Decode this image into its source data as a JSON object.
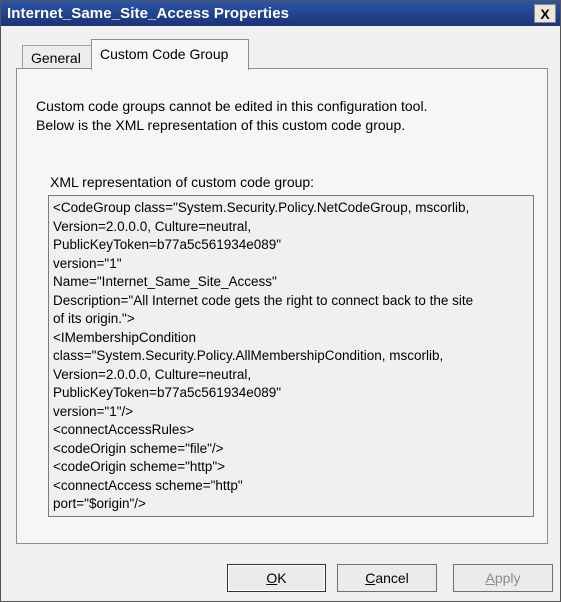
{
  "window": {
    "title": "Internet_Same_Site_Access Properties",
    "close_glyph": "X"
  },
  "tabs": [
    {
      "label": "General",
      "selected": false
    },
    {
      "label": "Custom Code Group",
      "selected": true
    }
  ],
  "panel": {
    "description_lines": [
      "Custom code groups cannot be edited in this configuration tool.",
      "Below is the XML representation of this custom code group."
    ],
    "xml_label": "XML representation of custom code group:",
    "xml_lines": [
      "<CodeGroup class=\"System.Security.Policy.NetCodeGroup, mscorlib,",
      "Version=2.0.0.0, Culture=neutral,",
      "PublicKeyToken=b77a5c561934e089\"",
      "version=\"1\"",
      "Name=\"Internet_Same_Site_Access\"",
      "Description=\"All Internet code gets the right to connect back to the site",
      "of its origin.\">",
      "<IMembershipCondition",
      "class=\"System.Security.Policy.AllMembershipCondition, mscorlib,",
      "Version=2.0.0.0, Culture=neutral,",
      "PublicKeyToken=b77a5c561934e089\"",
      "version=\"1\"/>",
      "<connectAccessRules>",
      "<codeOrigin scheme=\"file\"/>",
      "<codeOrigin scheme=\"http\">",
      "<connectAccess scheme=\"http\"",
      "port=\"$origin\"/>"
    ]
  },
  "buttons": {
    "ok": {
      "accel": "O",
      "rest": "K"
    },
    "cancel": {
      "accel": "C",
      "rest": "ancel"
    },
    "apply": {
      "accel": "A",
      "rest": "pply",
      "disabled": true
    }
  }
}
